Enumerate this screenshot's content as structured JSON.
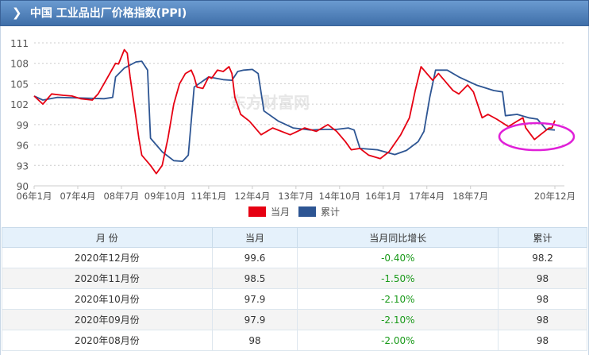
{
  "title": "中国 工业品出厂价格指数(PPI)",
  "watermark": "东方财富网 eastmoney.com",
  "colors": {
    "current": "#e60012",
    "cumulative": "#2d5593",
    "annotation": "#e020d8"
  },
  "chart_data": {
    "type": "line",
    "ylim": [
      90,
      111
    ],
    "yticks": [
      "90",
      "93",
      "96",
      "99",
      "102",
      "105",
      "108",
      "111"
    ],
    "xticks": [
      "06年1月",
      "07年4月",
      "08年7月",
      "09年10月",
      "11年1月",
      "12年4月",
      "13年7月",
      "14年10月",
      "16年1月",
      "17年4月",
      "18年7月",
      "20年12月"
    ],
    "xtick_months": [
      0,
      15,
      30,
      45,
      60,
      75,
      90,
      105,
      120,
      135,
      150,
      179
    ],
    "x_start": "2006-01",
    "x_end": "2020-12",
    "legend": [
      "当月",
      "累计"
    ],
    "legend_position": "bottom",
    "series": [
      {
        "name": "当月",
        "points": [
          [
            0,
            103.2
          ],
          [
            3,
            102
          ],
          [
            6,
            103.5
          ],
          [
            10,
            103.3
          ],
          [
            13,
            103.2
          ],
          [
            16,
            102.8
          ],
          [
            20,
            102.6
          ],
          [
            22,
            103.5
          ],
          [
            24,
            105
          ],
          [
            26,
            106.5
          ],
          [
            28,
            108
          ],
          [
            29,
            107.9
          ],
          [
            31,
            110
          ],
          [
            32,
            109.5
          ],
          [
            33,
            106
          ],
          [
            35,
            100
          ],
          [
            36,
            97
          ],
          [
            37,
            94.5
          ],
          [
            40,
            93
          ],
          [
            42,
            91.8
          ],
          [
            44,
            93
          ],
          [
            46,
            97
          ],
          [
            48,
            102
          ],
          [
            50,
            105
          ],
          [
            52,
            106.5
          ],
          [
            54,
            107
          ],
          [
            55,
            106
          ],
          [
            56,
            104.5
          ],
          [
            58,
            104.3
          ],
          [
            60,
            106
          ],
          [
            61,
            105.8
          ],
          [
            63,
            107
          ],
          [
            65,
            106.8
          ],
          [
            67,
            107.5
          ],
          [
            68,
            106.5
          ],
          [
            69,
            103
          ],
          [
            71,
            100.5
          ],
          [
            74,
            99.5
          ],
          [
            78,
            97.5
          ],
          [
            82,
            98.5
          ],
          [
            88,
            97.5
          ],
          [
            93,
            98.5
          ],
          [
            97,
            98
          ],
          [
            101,
            99
          ],
          [
            104,
            98
          ],
          [
            107,
            96.5
          ],
          [
            109,
            95.3
          ],
          [
            112,
            95.5
          ],
          [
            115,
            94.5
          ],
          [
            119,
            94
          ],
          [
            122,
            95
          ],
          [
            126,
            97.5
          ],
          [
            129,
            100
          ],
          [
            131,
            104
          ],
          [
            133,
            107.5
          ],
          [
            135,
            106.5
          ],
          [
            137,
            105.5
          ],
          [
            139,
            106.5
          ],
          [
            141,
            105.5
          ],
          [
            144,
            104
          ],
          [
            146,
            103.5
          ],
          [
            149,
            104.8
          ],
          [
            151,
            103.8
          ],
          [
            154,
            100
          ],
          [
            156,
            100.5
          ],
          [
            159,
            99.8
          ],
          [
            163,
            98.7
          ],
          [
            166,
            99.5
          ],
          [
            168,
            100
          ],
          [
            169,
            98.5
          ],
          [
            172,
            96.8
          ],
          [
            174,
            97.5
          ],
          [
            177,
            98.5
          ],
          [
            178,
            98.5
          ],
          [
            179,
            99.6
          ]
        ]
      },
      {
        "name": "累计",
        "points": [
          [
            0,
            103.2
          ],
          [
            3,
            102.6
          ],
          [
            8,
            103
          ],
          [
            16,
            102.9
          ],
          [
            24,
            102.8
          ],
          [
            27,
            103
          ],
          [
            28,
            106
          ],
          [
            31,
            107.3
          ],
          [
            35,
            108.2
          ],
          [
            37,
            108.3
          ],
          [
            39,
            107
          ],
          [
            40,
            97
          ],
          [
            44,
            95
          ],
          [
            48,
            93.7
          ],
          [
            51,
            93.6
          ],
          [
            53,
            94.5
          ],
          [
            55,
            104.5
          ],
          [
            60,
            106
          ],
          [
            65,
            105.6
          ],
          [
            68,
            105.5
          ],
          [
            70,
            106.8
          ],
          [
            72,
            107
          ],
          [
            75,
            107.1
          ],
          [
            77,
            106.5
          ],
          [
            79,
            101
          ],
          [
            84,
            99.5
          ],
          [
            89,
            98.5
          ],
          [
            95,
            98.2
          ],
          [
            100,
            98.3
          ],
          [
            104,
            98.3
          ],
          [
            108,
            98.5
          ],
          [
            110,
            98.2
          ],
          [
            112,
            95.5
          ],
          [
            118,
            95.3
          ],
          [
            124,
            94.6
          ],
          [
            128,
            95.2
          ],
          [
            132,
            96.5
          ],
          [
            134,
            98
          ],
          [
            136,
            103
          ],
          [
            138,
            107
          ],
          [
            142,
            107
          ],
          [
            146,
            106
          ],
          [
            152,
            104.8
          ],
          [
            158,
            104
          ],
          [
            161,
            103.8
          ],
          [
            162,
            100.3
          ],
          [
            166,
            100.5
          ],
          [
            170,
            100
          ],
          [
            173,
            99.8
          ],
          [
            176,
            98.3
          ],
          [
            179,
            98.2
          ]
        ]
      }
    ]
  },
  "table": {
    "headers": [
      "月  份",
      "当月",
      "当月同比增长",
      "累计"
    ],
    "rows": [
      [
        "2020年12月份",
        "99.6",
        "-0.40%",
        "98.2"
      ],
      [
        "2020年11月份",
        "98.5",
        "-1.50%",
        "98"
      ],
      [
        "2020年10月份",
        "97.9",
        "-2.10%",
        "98"
      ],
      [
        "2020年09月份",
        "97.9",
        "-2.10%",
        "98"
      ],
      [
        "2020年08月份",
        "98",
        "-2.00%",
        "98"
      ]
    ]
  }
}
